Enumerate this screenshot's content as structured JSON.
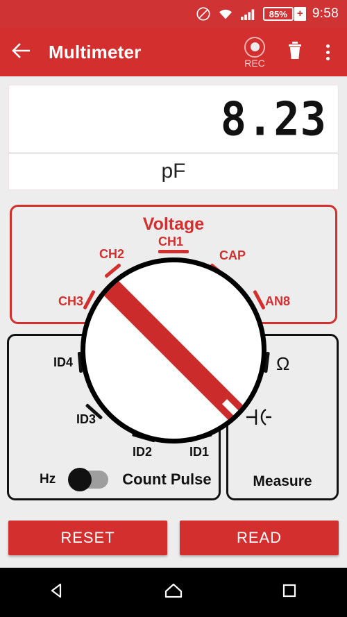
{
  "statusbar": {
    "icons": [
      "do-not-disturb-icon",
      "wifi-icon",
      "signal-icon"
    ],
    "battery_text": "85%",
    "battery_plus": "+",
    "time": "9:58"
  },
  "appbar": {
    "back_icon": "back-arrow-icon",
    "title": "Multimeter",
    "rec_label": "REC",
    "trash_icon": "trash-icon",
    "overflow_icon": "overflow-menu-icon"
  },
  "readout": {
    "value": "8.23",
    "unit": "pF"
  },
  "voltage_panel": {
    "title": "Voltage",
    "ticks": [
      {
        "label": "CH3"
      },
      {
        "label": "CH2"
      },
      {
        "label": "CH1"
      },
      {
        "label": "CAP"
      },
      {
        "label": "AN8"
      }
    ]
  },
  "count_panel": {
    "ticks": [
      {
        "label": "ID4"
      },
      {
        "label": "ID3"
      },
      {
        "label": "ID2"
      },
      {
        "label": "ID1"
      }
    ],
    "hz_label": "Hz",
    "toggle_state": "off",
    "count_pulse_label": "Count Pulse"
  },
  "measure_panel": {
    "label": "Measure",
    "ticks": [
      {
        "label": "Ω",
        "name": "ohm-symbol"
      },
      {
        "label": "⊣⊢",
        "name": "capacitor-symbol"
      }
    ]
  },
  "dial": {
    "selected": "capacitor",
    "pointer_angle_deg": 135
  },
  "buttons": {
    "reset": "RESET",
    "read": "READ"
  },
  "navbar": {
    "back": "nav-back-icon",
    "home": "nav-home-icon",
    "recents": "nav-recents-icon"
  },
  "colors": {
    "primary": "#d32f2f",
    "statusbar": "#cf3333",
    "pointer": "#cc2b2b",
    "panel_bg": "#ededed",
    "knob_outline": "#000000"
  }
}
